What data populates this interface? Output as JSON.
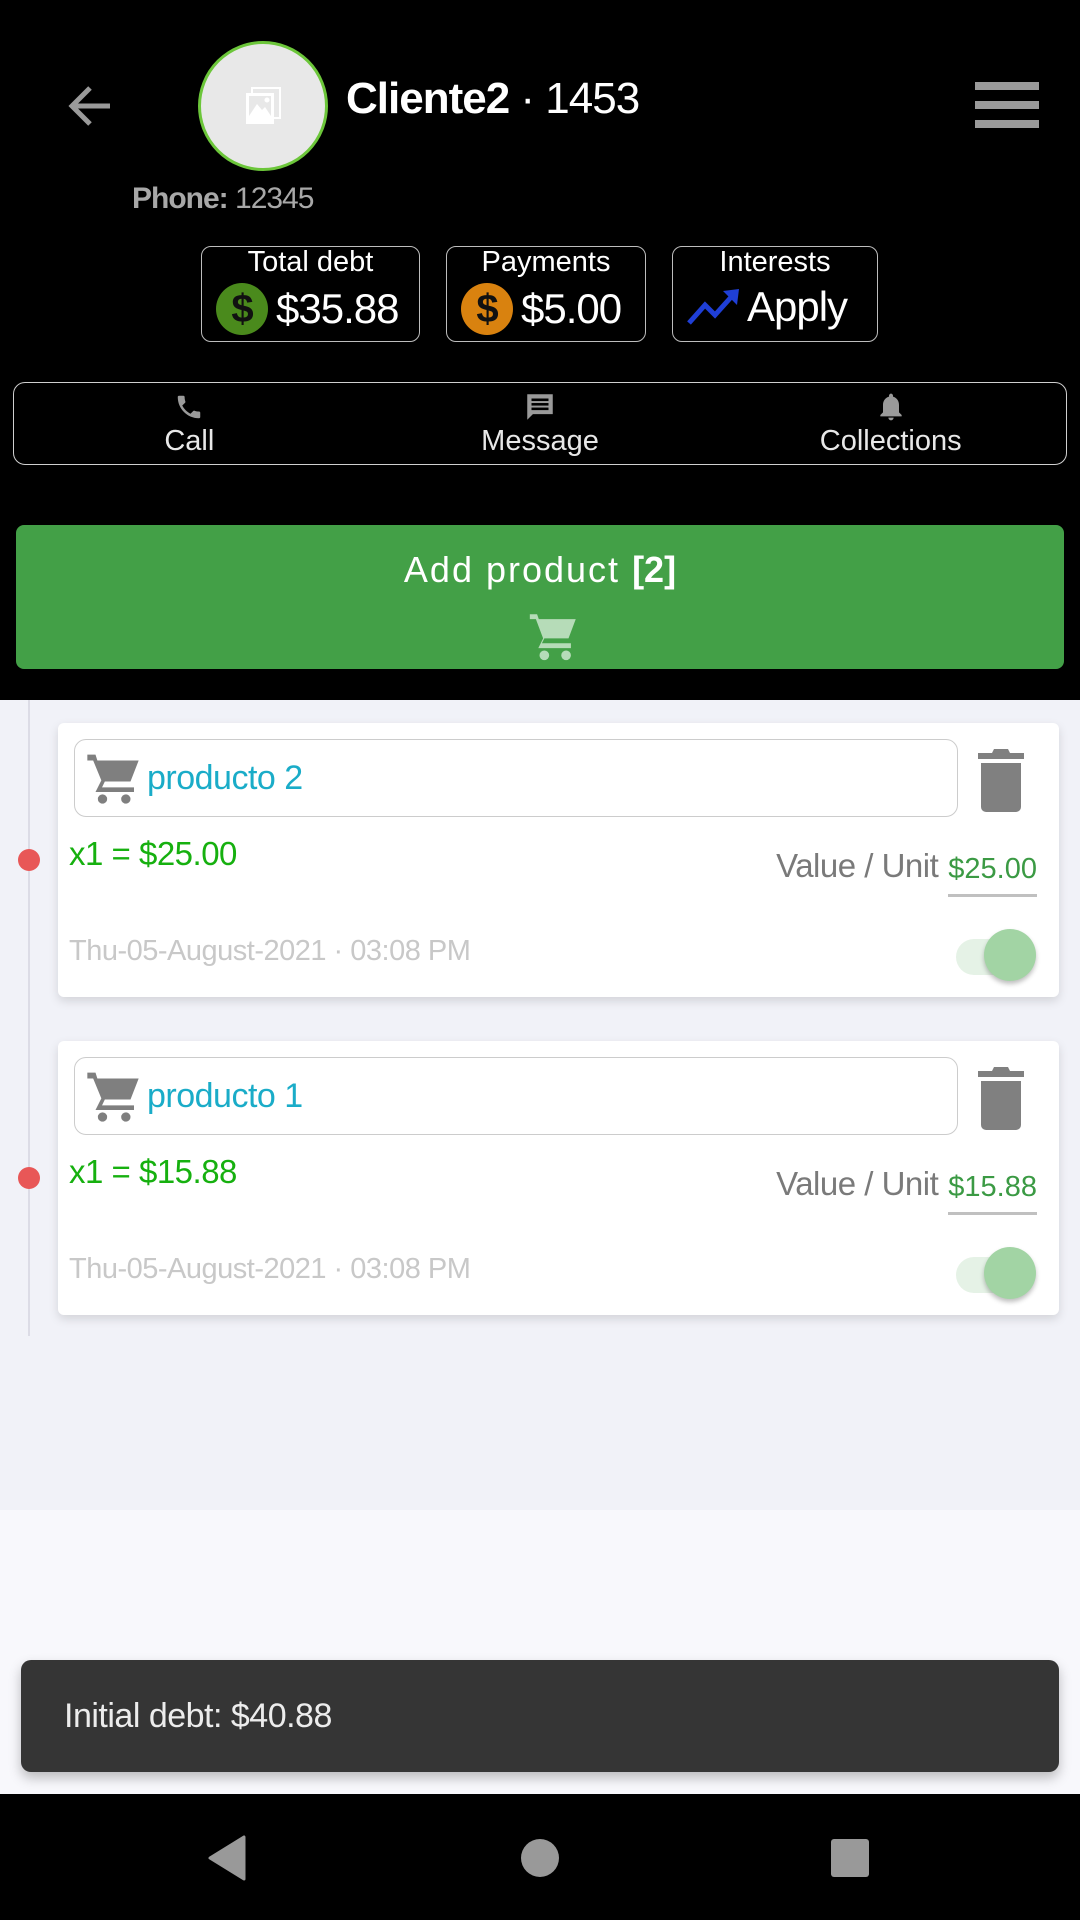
{
  "header": {
    "client_name": "Cliente2",
    "client_separator": " · ",
    "client_id": "1453",
    "phone_label": "Phone:",
    "phone_value": " 12345",
    "back_icon": "arrow-left-icon",
    "menu_icon": "hamburger-menu-icon",
    "avatar_icon": "image-placeholder-icon"
  },
  "stats": [
    {
      "label": "Total debt",
      "value": "$35.88",
      "icon": "dollar-coin-icon",
      "color": "#4a8a1c"
    },
    {
      "label": "Payments",
      "value": "$5.00",
      "icon": "dollar-coin-icon",
      "color": "#d9820f"
    },
    {
      "label": "Interests",
      "value": "Apply",
      "icon": "trending-up-icon",
      "color": "#1f3fd6"
    }
  ],
  "actions": [
    {
      "label": "Call",
      "icon": "phone-icon"
    },
    {
      "label": "Message",
      "icon": "message-icon"
    },
    {
      "label": "Collections",
      "icon": "bell-icon"
    }
  ],
  "add_product": {
    "label": "Add product ",
    "count": "[2]",
    "icon": "cart-icon",
    "color": "#43a047"
  },
  "products": [
    {
      "name": "producto 2",
      "quantity_text": "x1 = $25.00",
      "value_unit_label": "Value / Unit",
      "value_unit": "$25.00",
      "date": "Thu-05-August-2021  ·  03:08 PM",
      "enabled": true
    },
    {
      "name": "producto 1",
      "quantity_text": "x1 = $15.88",
      "value_unit_label": "Value / Unit",
      "value_unit": "$15.88",
      "date": "Thu-05-August-2021  ·  03:08 PM",
      "enabled": true
    }
  ],
  "snackbar": {
    "text": "Initial debt: $40.88"
  },
  "system_nav": {
    "back": "nav-back-icon",
    "home": "nav-home-icon",
    "recents": "nav-recents-icon"
  }
}
